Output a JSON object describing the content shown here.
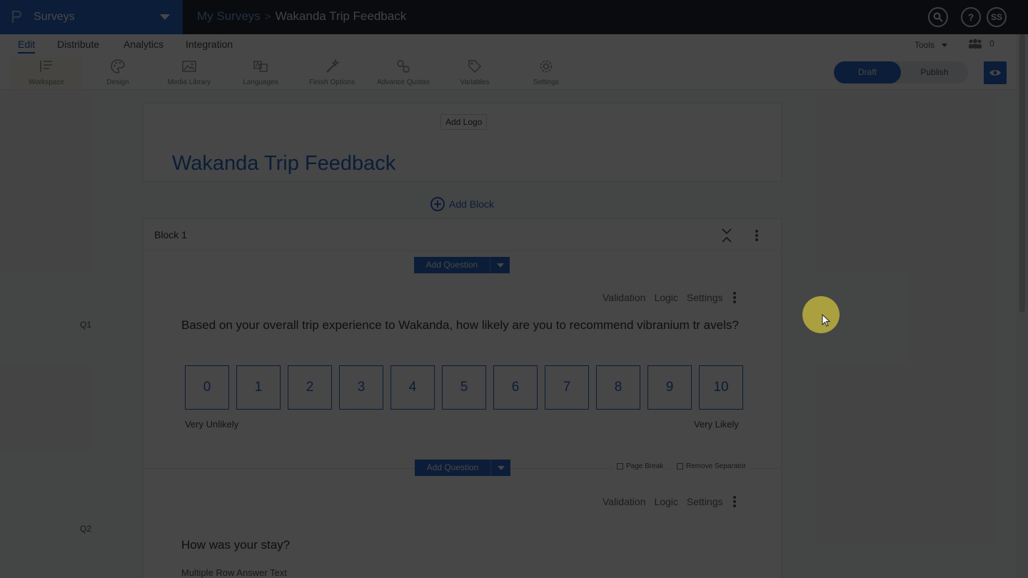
{
  "app": {
    "name": "Surveys"
  },
  "breadcrumb": {
    "parent": "My Surveys",
    "separator": ">",
    "current": "Wakanda Trip Feedback"
  },
  "topbar": {
    "help": "?",
    "avatar": "SS"
  },
  "tabs": [
    {
      "label": "Edit",
      "active": true
    },
    {
      "label": "Distribute"
    },
    {
      "label": "Analytics"
    },
    {
      "label": "Integration"
    }
  ],
  "tools_menu": {
    "label": "Tools",
    "collaborators": "0"
  },
  "toolbar": [
    {
      "label": "Workspace",
      "icon": "list-icon",
      "active": true
    },
    {
      "label": "Design",
      "icon": "palette-icon"
    },
    {
      "label": "Media Library",
      "icon": "image-icon"
    },
    {
      "label": "Languages",
      "icon": "translate-icon"
    },
    {
      "label": "Finish Options",
      "icon": "wand-icon"
    },
    {
      "label": "Advance Quotas",
      "icon": "quota-icon"
    },
    {
      "label": "Variables",
      "icon": "tag-icon"
    },
    {
      "label": "Settings",
      "icon": "gear-icon"
    }
  ],
  "status_toggle": {
    "draft": "Draft",
    "publish": "Publish",
    "selected": "Draft"
  },
  "survey": {
    "add_logo": "Add Logo",
    "title": "Wakanda Trip Feedback",
    "add_block": "Add Block",
    "block": {
      "title": "Block 1"
    },
    "add_question": "Add Question",
    "question_actions": {
      "validation": "Validation",
      "logic": "Logic",
      "settings": "Settings"
    },
    "q1": {
      "number": "Q1",
      "text": "Based on your overall trip experience to Wakanda, how likely are you to recommend vibranium tr avels?",
      "scale": [
        "0",
        "1",
        "2",
        "3",
        "4",
        "5",
        "6",
        "7",
        "8",
        "9",
        "10"
      ],
      "low_label": "Very Unlikely",
      "high_label": "Very Likely"
    },
    "separator": {
      "page_break": "Page Break",
      "remove_separator": "Remove Separator"
    },
    "q2": {
      "number": "Q2",
      "text": "How was your stay?",
      "sub": "Multiple Row Answer Text"
    }
  },
  "colors": {
    "brand": "#2a68c8",
    "topbar": "#222a33"
  }
}
